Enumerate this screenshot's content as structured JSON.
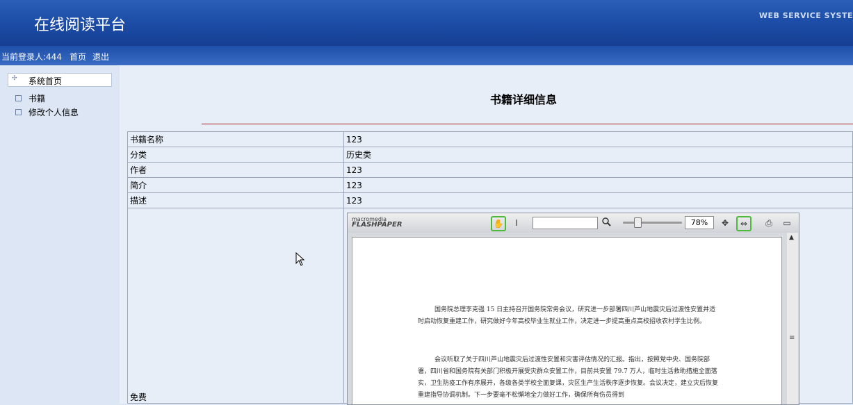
{
  "header": {
    "title": "在线阅读平台",
    "system_label": "WEB SERVICE SYSTE"
  },
  "userbar": {
    "login_text": "当前登录人:444",
    "home_link": "首页",
    "logout_link": "退出"
  },
  "sidebar": {
    "home": "系统首页",
    "items": [
      {
        "label": "书籍"
      },
      {
        "label": "修改个人信息"
      }
    ]
  },
  "main": {
    "title": "书籍详细信息",
    "rows": [
      {
        "label": "书籍名称",
        "value": "123"
      },
      {
        "label": "分类",
        "value": "历史类"
      },
      {
        "label": "作者",
        "value": "123"
      },
      {
        "label": "简介",
        "value": "123"
      },
      {
        "label": "描述",
        "value": "123"
      }
    ],
    "free_label": "免费"
  },
  "viewer": {
    "brand_small": "macromedia",
    "brand_large": "FLASHPAPER",
    "zoom": "78%",
    "paragraph1": "国务院总理李克强 15 日主持召开国务院常务会议，研究进一步部署四川芦山地震灾后过渡性安置并适时启动恢复重建工作，研究做好今年高校毕业生就业工作，决定进一步提高重点高校招收农村学生比例。",
    "paragraph2": "会议听取了关于四川芦山地震灾后过渡性安置和灾害评估情况的汇报。指出，按照党中央、国务院部署，四川省和国务院有关部门积极开展受灾群众安置工作，目前共安置 79.7 万人，临时生活救助措施全面落实，卫生防疫工作有序展开，各级各类学校全面复课，灾区生产生活秩序逐步恢复。会议决定，建立灾后恢复重建指导协调机制。下一步要毫不松懈地全力做好工作，确保所有伤员得到"
  },
  "icons": {
    "hand": "hand-tool-icon",
    "text_select": "text-select-icon",
    "search": "magnifier-icon",
    "fit": "fit-page-icon",
    "fit_width": "fit-width-icon",
    "print": "print-icon",
    "fullscreen": "fullscreen-icon"
  }
}
